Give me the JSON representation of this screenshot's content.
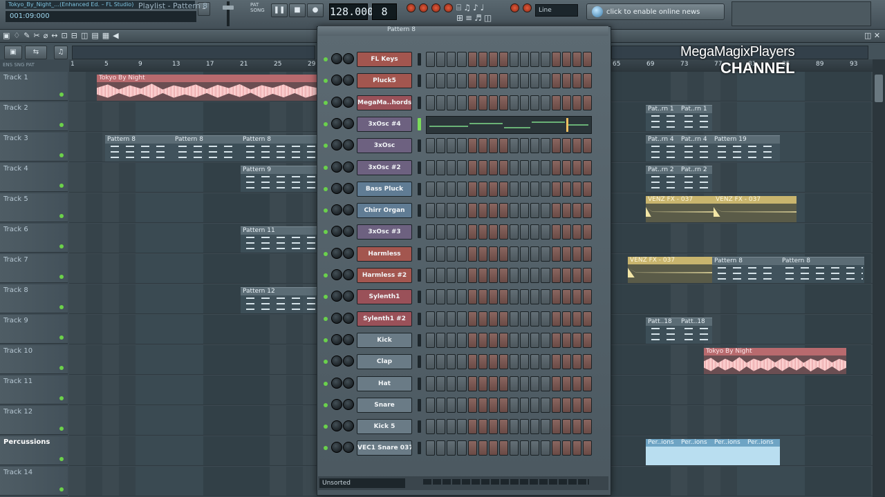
{
  "toolbar": {
    "song_title": "Tokyo_By_Night_…(Enhanced Ed. – FL Studio)",
    "hint": "001:09:000",
    "tempo": "128.000",
    "pattern_number": "8",
    "snap": "Line",
    "news": "click to enable online news"
  },
  "playlist": {
    "title": "Playlist - Pattern 8"
  },
  "ruler": [
    "1",
    "5",
    "9",
    "13",
    "17",
    "21",
    "25",
    "29",
    "65",
    "69",
    "73",
    "77",
    "81",
    "85",
    "89",
    "93"
  ],
  "tracks": [
    {
      "name": "Track 1"
    },
    {
      "name": "Track 2"
    },
    {
      "name": "Track 3"
    },
    {
      "name": "Track 4"
    },
    {
      "name": "Track 5"
    },
    {
      "name": "Track 6"
    },
    {
      "name": "Track 7"
    },
    {
      "name": "Track 8"
    },
    {
      "name": "Track 9"
    },
    {
      "name": "Track 10"
    },
    {
      "name": "Track 11"
    },
    {
      "name": "Track 12"
    },
    {
      "name": "Percussions"
    },
    {
      "name": "Track 14"
    }
  ],
  "clips": {
    "tokyo1": "Tokyo By Night",
    "pattern8": "Pattern 8",
    "pattern9": "Pattern 9",
    "pattern11": "Pattern 11",
    "pattern12": "Pattern 12",
    "patrn1": "Pat..rn 1",
    "patrn4": "Pat..rn 4",
    "pattern19": "Pattern 19",
    "patrn2": "Pat..rn 2",
    "venz1": "VENZ FX - 037",
    "patt18": "Patt..18",
    "tokyo2": "Tokyo By Night",
    "perions": "Per..ions"
  },
  "channel_rack": {
    "title": "Pattern 8",
    "channels": [
      {
        "name": "FL Keys",
        "color": "#a3564f"
      },
      {
        "name": "Pluck5",
        "color": "#a3564f"
      },
      {
        "name": "MegaMa..hords",
        "color": "#9a5159"
      },
      {
        "name": "3xOsc #4",
        "color": "#6d6180"
      },
      {
        "name": "3xOsc",
        "color": "#6d6180"
      },
      {
        "name": "3xOsc #2",
        "color": "#6d6180"
      },
      {
        "name": "Bass Pluck",
        "color": "#607c94"
      },
      {
        "name": "Chirr Organ",
        "color": "#607c94"
      },
      {
        "name": "3xOsc #3",
        "color": "#6d6180"
      },
      {
        "name": "Harmless",
        "color": "#a3564f"
      },
      {
        "name": "Harmless #2",
        "color": "#a3564f"
      },
      {
        "name": "Sylenth1",
        "color": "#9a5159"
      },
      {
        "name": "Sylenth1 #2",
        "color": "#9a5159"
      },
      {
        "name": "Kick",
        "color": "#6a7b86"
      },
      {
        "name": "Clap",
        "color": "#6a7b86"
      },
      {
        "name": "Hat",
        "color": "#6a7b86"
      },
      {
        "name": "Snare",
        "color": "#6a7b86"
      },
      {
        "name": "Kick 5",
        "color": "#6a7b86"
      },
      {
        "name": "VEC1 Snare 037",
        "color": "#6a7b86"
      }
    ],
    "filter": "Unsorted"
  },
  "watermark": {
    "line1": "MegaMagixPlayers",
    "line2": "CHANNEL"
  }
}
